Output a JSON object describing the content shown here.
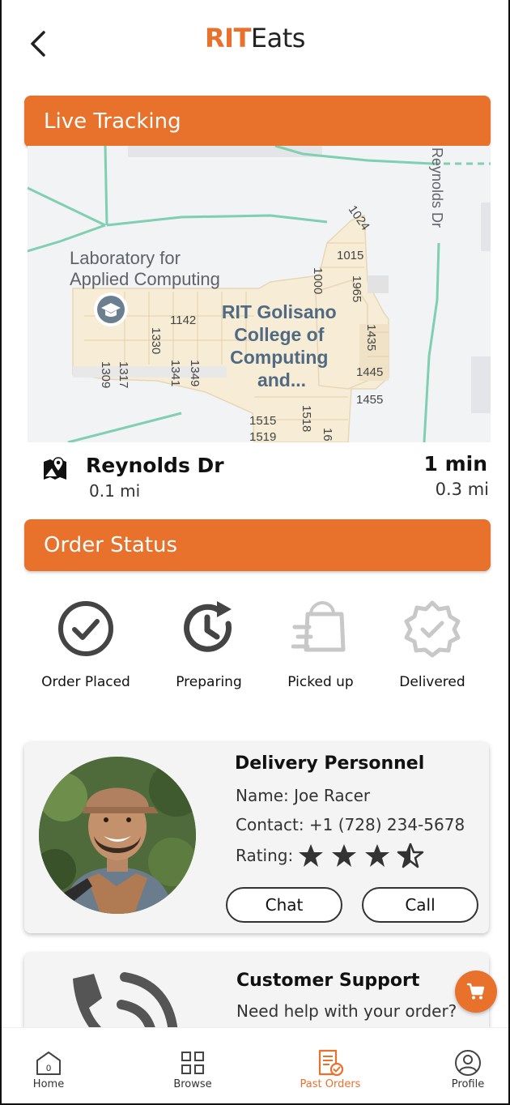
{
  "header": {
    "brand_prefix": "RIT",
    "brand_suffix": "Eats"
  },
  "live_tracking": {
    "title": "Live Tracking",
    "map": {
      "building_label_lines": [
        "RIT Golisano",
        "College of",
        "Computing",
        "and..."
      ],
      "poi_label_lines": [
        "Laboratory for",
        "Applied Computing"
      ],
      "street_label": "Reynolds Dr",
      "room_numbers": [
        "1024",
        "1015",
        "1000",
        "1965",
        "1142",
        "1330",
        "1309",
        "1317",
        "1341",
        "1349",
        "1435",
        "1445",
        "1455",
        "1515",
        "1519",
        "1518",
        "16"
      ]
    },
    "route": {
      "street": "Reynolds Dr",
      "distance": "0.1 mi",
      "eta": "1 min",
      "eta_distance": "0.3 mi"
    }
  },
  "order_status": {
    "title": "Order Status",
    "steps": [
      {
        "label": "Order Placed",
        "state": "done"
      },
      {
        "label": "Preparing",
        "state": "done"
      },
      {
        "label": "Picked up",
        "state": "pending"
      },
      {
        "label": "Delivered",
        "state": "pending"
      }
    ]
  },
  "courier": {
    "title": "Delivery Personnel",
    "name": "Name: Joe Racer",
    "contact": "Contact: +1 (728) 234-5678",
    "rating_label": "Rating:",
    "rating": 3.5,
    "rating_max": 4,
    "chat_label": "Chat",
    "call_label": "Call"
  },
  "support": {
    "title": "Customer Support",
    "subtitle": "Need help with your order?"
  },
  "cart": {
    "badge_icon": "cart-icon"
  },
  "bottom_nav": {
    "items": [
      {
        "label": "Home",
        "icon": "home-icon",
        "badge": "0"
      },
      {
        "label": "Browse",
        "icon": "grid-icon"
      },
      {
        "label": "Past Orders",
        "icon": "receipt-icon",
        "active": true
      },
      {
        "label": "Profile",
        "icon": "profile-icon"
      }
    ]
  },
  "colors": {
    "accent": "#e8712c",
    "done_icon": "#444444",
    "pending_icon": "#c8c8c8",
    "map_path": "#7fcfb0"
  }
}
